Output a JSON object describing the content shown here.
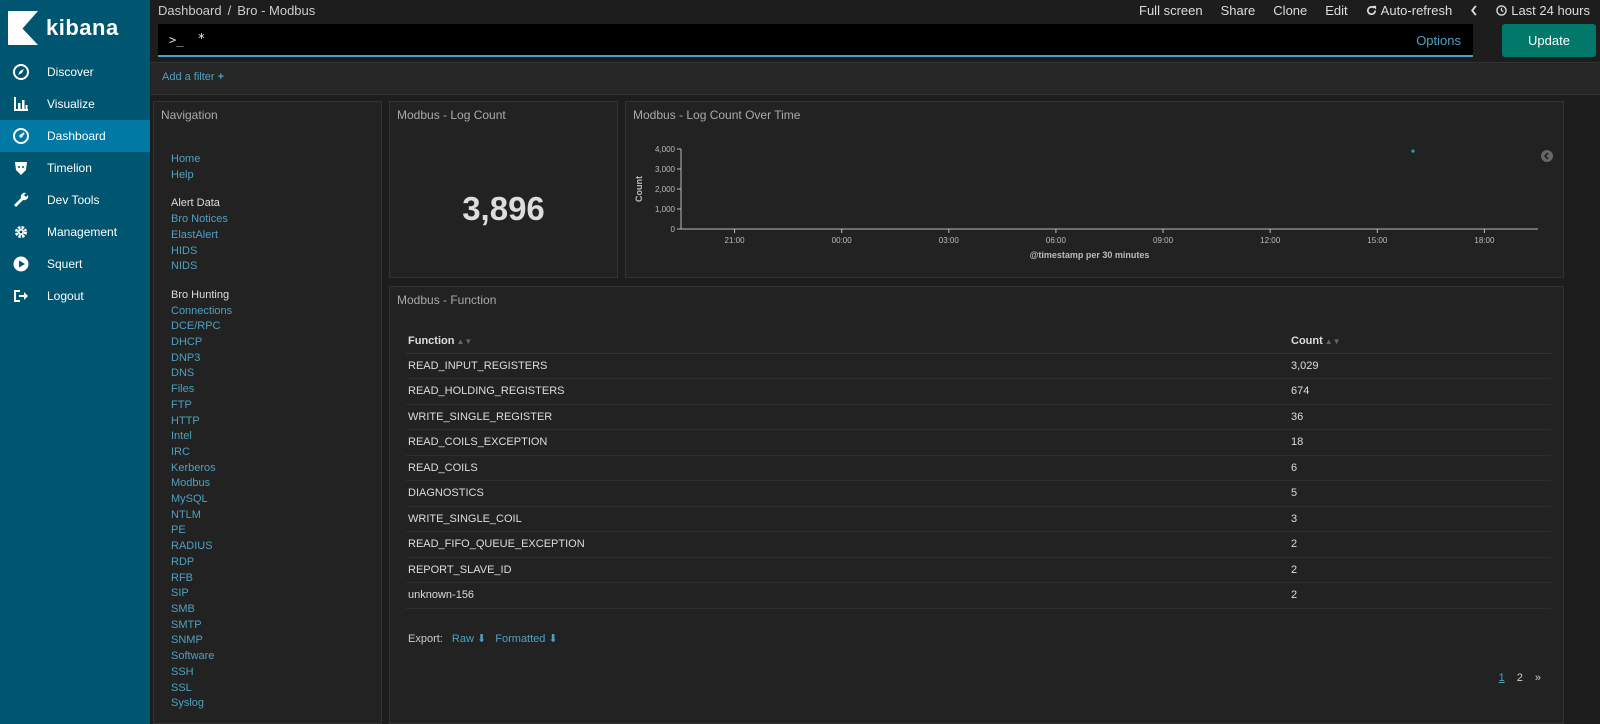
{
  "app": {
    "name": "kibana"
  },
  "sidebar": {
    "items": [
      {
        "label": "Discover",
        "icon": "compass-icon"
      },
      {
        "label": "Visualize",
        "icon": "bar-chart-icon"
      },
      {
        "label": "Dashboard",
        "icon": "dashboard-icon",
        "active": true
      },
      {
        "label": "Timelion",
        "icon": "timelion-icon"
      },
      {
        "label": "Dev Tools",
        "icon": "wrench-icon"
      },
      {
        "label": "Management",
        "icon": "gear-icon"
      },
      {
        "label": "Squert",
        "icon": "play-icon"
      },
      {
        "label": "Logout",
        "icon": "logout-icon"
      }
    ]
  },
  "header": {
    "breadcrumb_root": "Dashboard",
    "breadcrumb_sep": "/",
    "breadcrumb_current": "Bro - Modbus",
    "full_screen": "Full screen",
    "share": "Share",
    "clone": "Clone",
    "edit": "Edit",
    "auto_refresh": "Auto-refresh",
    "time_range": "Last 24 hours",
    "prompt": ">_",
    "query": "*",
    "options": "Options",
    "update": "Update",
    "add_filter": "Add a filter"
  },
  "nav_panel": {
    "title": "Navigation",
    "top_links": [
      "Home",
      "Help"
    ],
    "alert_heading": "Alert Data",
    "alert_links": [
      "Bro Notices",
      "ElastAlert",
      "HIDS",
      "NIDS"
    ],
    "hunting_heading": "Bro Hunting",
    "hunting_links": [
      "Connections",
      "DCE/RPC",
      "DHCP",
      "DNP3",
      "DNS",
      "Files",
      "FTP",
      "HTTP",
      "Intel",
      "IRC",
      "Kerberos",
      "Modbus",
      "MySQL",
      "NTLM",
      "PE",
      "RADIUS",
      "RDP",
      "RFB",
      "SIP",
      "SMB",
      "SMTP",
      "SNMP",
      "Software",
      "SSH",
      "SSL",
      "Syslog"
    ]
  },
  "metric_panel": {
    "title": "Modbus - Log Count",
    "value": "3,896"
  },
  "chart_panel": {
    "title": "Modbus - Log Count Over Time"
  },
  "chart_data": {
    "type": "line",
    "title": "Modbus - Log Count Over Time",
    "xlabel": "@timestamp per 30 minutes",
    "ylabel": "Count",
    "x_ticks": [
      "21:00",
      "00:00",
      "03:00",
      "06:00",
      "09:00",
      "12:00",
      "15:00",
      "18:00"
    ],
    "y_ticks": [
      "0",
      "1,000",
      "2,000",
      "3,000",
      "4,000"
    ],
    "ylim": [
      0,
      4000
    ],
    "xlim_hours": [
      19.5,
      43.5
    ],
    "series": [
      {
        "points": [
          {
            "x": "16:00",
            "y": 3896
          }
        ]
      }
    ]
  },
  "table_panel": {
    "title": "Modbus - Function",
    "columns": [
      "Function",
      "Count"
    ],
    "rows": [
      [
        "READ_INPUT_REGISTERS",
        "3,029"
      ],
      [
        "READ_HOLDING_REGISTERS",
        "674"
      ],
      [
        "WRITE_SINGLE_REGISTER",
        "36"
      ],
      [
        "READ_COILS_EXCEPTION",
        "18"
      ],
      [
        "READ_COILS",
        "6"
      ],
      [
        "DIAGNOSTICS",
        "5"
      ],
      [
        "WRITE_SINGLE_COIL",
        "3"
      ],
      [
        "READ_FIFO_QUEUE_EXCEPTION",
        "2"
      ],
      [
        "REPORT_SLAVE_ID",
        "2"
      ],
      [
        "unknown-156",
        "2"
      ]
    ],
    "export_label": "Export:",
    "export_raw": "Raw",
    "export_formatted": "Formatted",
    "pages": [
      "1",
      "2"
    ],
    "next": "»"
  }
}
